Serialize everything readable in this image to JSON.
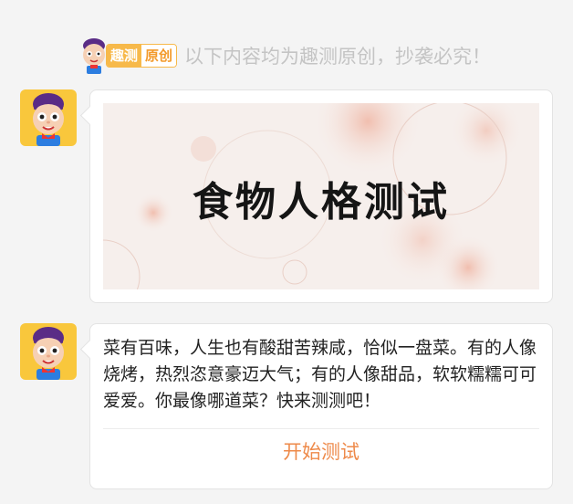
{
  "notice": {
    "badge_part1": "趣测",
    "badge_part2": "原创",
    "text": "以下内容均为趣测原创，抄袭必究！"
  },
  "icons": {
    "mascot": "mascot-avatar-icon"
  },
  "banner": {
    "title": "食物人格测试"
  },
  "message": {
    "text": "菜有百味，人生也有酸甜苦辣咸，恰似一盘菜。有的人像烧烤，热烈恣意豪迈大气；有的人像甜品，软软糯糯可可爱爱。你最像哪道菜？快来测测吧！",
    "button_label": "开始测试"
  },
  "colors": {
    "background": "#f4f4f4",
    "avatar_bg": "#f9c73c",
    "accent": "#ee8a4a",
    "badge": "#f7b94a"
  }
}
